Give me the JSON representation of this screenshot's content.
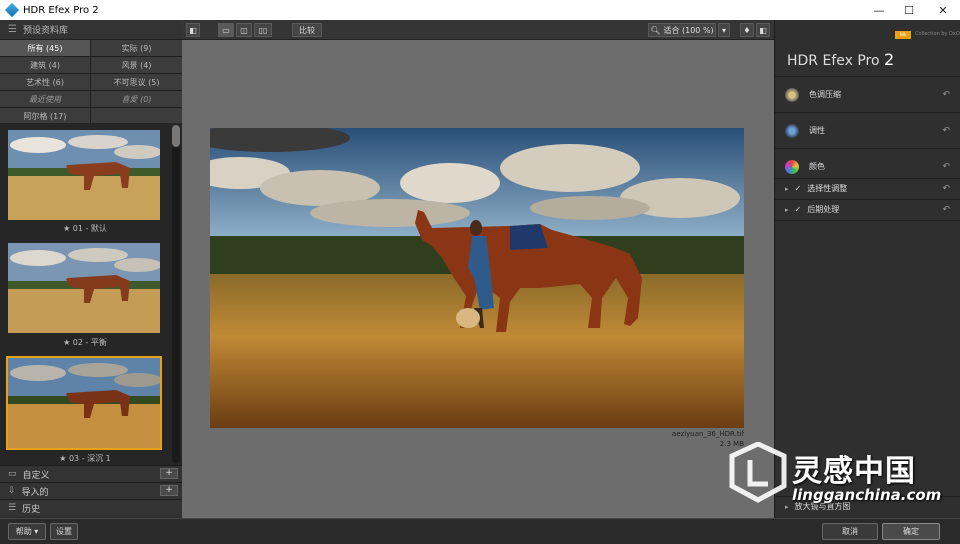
{
  "window": {
    "title": "HDR Efex Pro 2",
    "min": "—",
    "max": "☐",
    "close": "✕"
  },
  "left": {
    "presets_header": "预设资料库",
    "categories": [
      {
        "label": "所有 (45)",
        "selected": true
      },
      {
        "label": "实际 (9)"
      },
      {
        "label": "建筑 (4)"
      },
      {
        "label": "风景 (4)"
      },
      {
        "label": "艺术性 (6)"
      },
      {
        "label": "不可思议 (5)"
      },
      {
        "label": "最近使用",
        "dim": true
      },
      {
        "label": "喜爱 (0)",
        "dim": true
      },
      {
        "label": "阿尔格 (17)"
      },
      {
        "label": ""
      }
    ],
    "thumbs": [
      {
        "caption": "★ 01 - 默认"
      },
      {
        "caption": "★ 02 - 平衡"
      },
      {
        "caption": "★ 03 - 深沉 1"
      }
    ],
    "custom_label": "自定义",
    "imported_label": "导入的",
    "history_label": "历史",
    "plus": "+"
  },
  "toolbar": {
    "compare_label": "比较",
    "zoom_label": "适合 (100 %)"
  },
  "image": {
    "filename": "aeziyuan_36_HDR.tif",
    "size": "2.3 MB"
  },
  "right": {
    "app_name": "HDR Efex Pro",
    "app_version": "2",
    "brand_small": "Nik",
    "brand_text": "Collection by DxO",
    "sections": [
      {
        "label": "色调压缩"
      },
      {
        "label": "调性"
      },
      {
        "label": "颜色"
      }
    ],
    "subsections": [
      {
        "label": "选择性调整"
      },
      {
        "label": "后期处理"
      }
    ],
    "loupe_label": "放大镜与直方图",
    "reset_icon": "↶"
  },
  "bottom": {
    "help_label": "帮助 ▾",
    "settings_label": "设置",
    "cancel_label": "取消",
    "ok_label": "确定"
  },
  "watermark": {
    "name": "灵感中国",
    "url": "lingganchina.com"
  },
  "colors": {
    "accent": "#e8a21a",
    "panel": "#2f2f2f",
    "canvas": "#6d6d6d"
  }
}
